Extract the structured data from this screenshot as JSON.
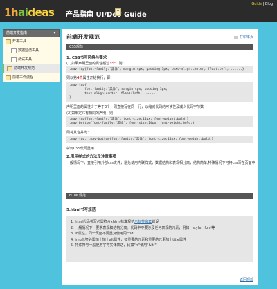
{
  "header": {
    "logo_part1": "1h",
    "logo_part2": "ai",
    "logo_part3": "deas",
    "title": "产品指南 UI/Dev Guide",
    "links": {
      "guide": "Guide",
      "sep": " | ",
      "blog": "Blog"
    }
  },
  "sidebar": {
    "heading": "前端开发指南",
    "items": [
      {
        "label": "开发工具"
      },
      {
        "label": "数据监测工具"
      },
      {
        "label": "测试工具"
      },
      {
        "label": "前端开发规范"
      },
      {
        "label": "前端工作流程"
      }
    ]
  },
  "main": {
    "title": "前端开发规范",
    "print": "打印本页",
    "css_section": "CSS规范",
    "css_h1": "1. CSS书写风格与要求",
    "css_p1a": "(1)如果声明里面的属性超过",
    "css_p1b": "3个",
    "css_p1c": "，则：",
    "code1": ".nav-top{font-family:\"黑体\"; margin:4px; padding:3px; text-align:center; float:left; ......}",
    "css_p2a": "则以第",
    "css_p2b": "4个",
    "css_p2c": "属性开始换行，即：",
    "code2": ".nav-top{\n        font-family:\"黑体\"; margin:4px; padding:3px;\n        text-align:center; float:left; ......\n}",
    "css_p3": "声明里面的属性少于等于3个，则直接写在同一行，以缩减代码的可读性及减少代码字节数",
    "css_p4": "(2)如果定义有相同的声明，则：",
    "code3": ".nav-top{font-family:\"黑体\"; font-size:14px; font-weight:bold;}\n.nav-bottom{font-family:\"黑体\"; font-size:14px; font-weight:bold;}",
    "css_p5": "则将其合并为：",
    "code4": ".nav-top, .nav-bottom{font-family:\"黑体\"; font-size:14px; font-weight:bold;}",
    "css_p6": "彰到CSS代码重用",
    "css_h2": "2.引用样式的方法及注意事项",
    "css_p7": "一般情况下，直接引用外部css文件，避免使用内联样式，数据结构和表现相分离，结构简单,特殊情况下可将css写在页面中",
    "html_section": "HTML规范",
    "html_h1": "5.html书写规范",
    "list": {
      "i1a": "1. html代码书写必需符合xhtml标准规范",
      "i1b": "示标签嵌套",
      "i1c": "错误",
      "i2": "2. 一般情况下，要求表现和结构分离。代码中不要涉及任何表现的元素，例如：style、font等",
      "i3": "3. id属性，同一页面不要重复使用同一id",
      "i4": "4. img标签必需加上加上alt属性，如重要的元素和重要的元素加上title属性",
      "i5": "5. 特殊符号一般使用字符实体表达，比如\"<\"使用\"&lt;\""
    },
    "back_top": "返回顶部"
  }
}
